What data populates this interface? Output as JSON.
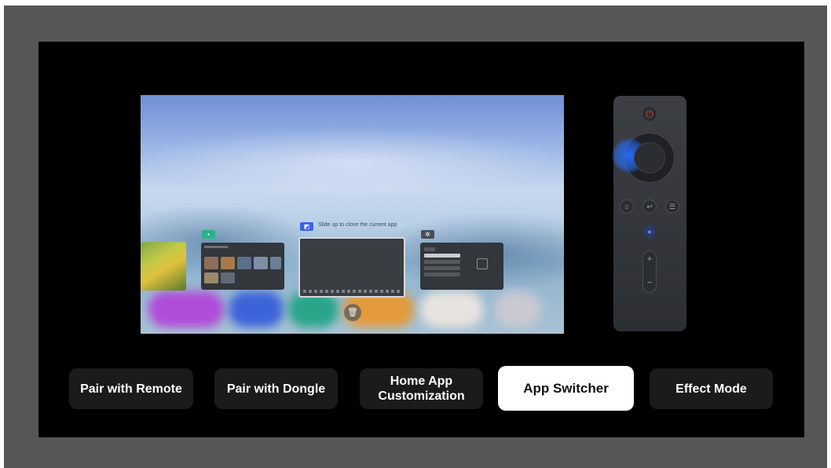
{
  "preview": {
    "swipe_hint": "Slide up to close the current app"
  },
  "remote": {
    "icons": [
      "power-icon",
      "home-icon",
      "back-icon",
      "menu-icon",
      "mic-icon",
      "plus-icon",
      "minus-icon"
    ],
    "power_glyph": "⏻",
    "home_glyph": "⌂",
    "back_glyph": "↩",
    "menu_glyph": "☰",
    "mic_glyph": "●",
    "plus_glyph": "+",
    "minus_glyph": "−",
    "highlight_color": "#2f6bff"
  },
  "tabs": [
    {
      "label": "Pair with Remote",
      "active": false
    },
    {
      "label": "Pair with Dongle",
      "active": false
    },
    {
      "label": "Home App Customization",
      "active": false
    },
    {
      "label": "App Switcher",
      "active": true
    },
    {
      "label": "Effect Mode",
      "active": false
    }
  ],
  "colors": {
    "background": "#000000",
    "frame": "#565656",
    "tab_inactive": "#1b1b1b",
    "tab_active": "#ffffff"
  }
}
